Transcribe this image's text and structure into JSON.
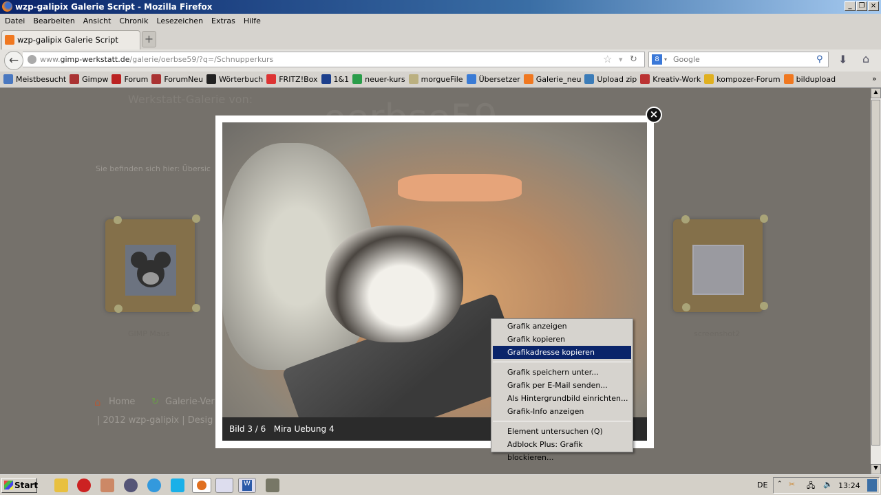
{
  "window": {
    "title": "wzp-galipix Galerie Script - Mozilla Firefox"
  },
  "menu": [
    "Datei",
    "Bearbeiten",
    "Ansicht",
    "Chronik",
    "Lesezeichen",
    "Extras",
    "Hilfe"
  ],
  "tab": {
    "label": "wzp-galipix Galerie Script",
    "new_tab": "+"
  },
  "address": {
    "prefix": "www.",
    "domain": "gimp-werkstatt.de",
    "path": "/galerie/oerbse59/?q=/Schnupperkurs"
  },
  "search": {
    "placeholder": "Google"
  },
  "bookmarks": [
    {
      "label": "Meistbesucht",
      "color": "#4a78c0"
    },
    {
      "label": "Gimpw",
      "color": "#a33"
    },
    {
      "label": "Forum",
      "color": "#b22"
    },
    {
      "label": "ForumNeu",
      "color": "#a33"
    },
    {
      "label": "Wörterbuch",
      "color": "#222"
    },
    {
      "label": "FRITZ!Box",
      "color": "#d33"
    },
    {
      "label": "1&1",
      "color": "#1c3f8c"
    },
    {
      "label": "neuer-kurs",
      "color": "#2a9d4a"
    },
    {
      "label": "morgueFile",
      "color": "#bbb080"
    },
    {
      "label": "Übersetzer",
      "color": "#3a7bd5"
    },
    {
      "label": "Galerie_neu",
      "color": "#f07820"
    },
    {
      "label": "Upload zip",
      "color": "#3b7cb8"
    },
    {
      "label": "Kreativ-Work",
      "color": "#b33"
    },
    {
      "label": "kompozer-Forum",
      "color": "#e0b020"
    },
    {
      "label": "bildupload",
      "color": "#f07820"
    }
  ],
  "bookmarks_more": "»",
  "page": {
    "heading": "Werkstatt-Galerie von:",
    "gallery_owner": "oerbse59",
    "breadcrumb": "Sie befinden sich hier: Übersic",
    "thumbs": [
      "GIMP Maus",
      "screenshot2"
    ],
    "nav": [
      "Home",
      "Galerie-Ver"
    ],
    "footer": "| 2012 wzp-galipix | Desig"
  },
  "lightbox": {
    "counter": "Bild 3 / 6",
    "title": "Mira Uebung 4",
    "close": "×"
  },
  "context_menu": {
    "groups": [
      [
        "Grafik anzeigen",
        "Grafik kopieren",
        "Grafikadresse kopieren"
      ],
      [
        "Grafik speichern unter...",
        "Grafik per E-Mail senden...",
        "Als Hintergrundbild einrichten...",
        "Grafik-Info anzeigen"
      ],
      [
        "Element untersuchen (Q)",
        "Adblock Plus: Grafik blockieren..."
      ]
    ],
    "selected": "Grafikadresse kopieren"
  },
  "taskbar": {
    "start": "Start",
    "lang": "DE",
    "clock": "13:24"
  }
}
